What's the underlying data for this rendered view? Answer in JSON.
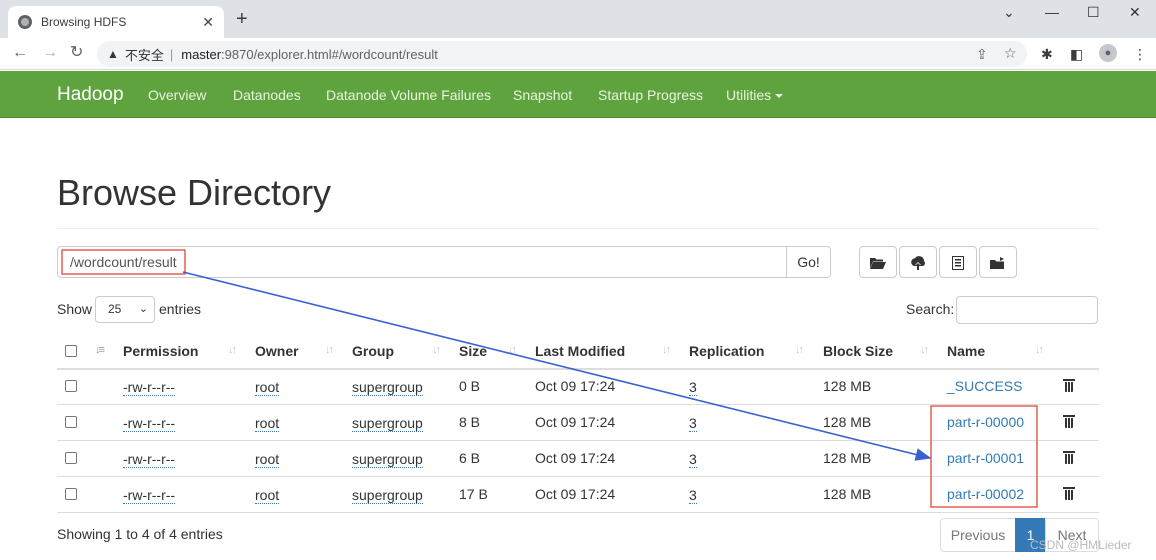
{
  "browser": {
    "tab_title": "Browsing HDFS",
    "tab_close": "✕",
    "new_tab": "+",
    "url_warning": "▲",
    "url_insecure": "不安全",
    "url_sep": "|",
    "url_host": "master",
    "url_path": ":9870/explorer.html#/wordcount/result",
    "win_minimize": "—",
    "win_maximize": "☐",
    "win_close": "✕",
    "win_chevron": "⌄",
    "nav_back": "←",
    "nav_forward": "→",
    "nav_reload": "↻",
    "icons": [
      "share-icon",
      "star-icon",
      "extensions-icon",
      "sidepanel-icon",
      "profile-icon",
      "menu-icon"
    ]
  },
  "navbar": {
    "brand": "Hadoop",
    "items": [
      "Overview",
      "Datanodes",
      "Datanode Volume Failures",
      "Snapshot",
      "Startup Progress",
      "Utilities"
    ]
  },
  "page": {
    "title": "Browse Directory",
    "directory": "/wordcount/result",
    "go_label": "Go!",
    "show_label": "Show",
    "page_size": "25",
    "entries_label": "entries",
    "search_label": "Search:"
  },
  "table": {
    "headers": [
      "Permission",
      "Owner",
      "Group",
      "Size",
      "Last Modified",
      "Replication",
      "Block Size",
      "Name"
    ],
    "rows": [
      {
        "permission": "-rw-r--r--",
        "owner": "root",
        "group": "supergroup",
        "size": "0 B",
        "modified": "Oct 09 17:24",
        "replication": "3",
        "block_size": "128 MB",
        "name": "_SUCCESS"
      },
      {
        "permission": "-rw-r--r--",
        "owner": "root",
        "group": "supergroup",
        "size": "8 B",
        "modified": "Oct 09 17:24",
        "replication": "3",
        "block_size": "128 MB",
        "name": "part-r-00000"
      },
      {
        "permission": "-rw-r--r--",
        "owner": "root",
        "group": "supergroup",
        "size": "6 B",
        "modified": "Oct 09 17:24",
        "replication": "3",
        "block_size": "128 MB",
        "name": "part-r-00001"
      },
      {
        "permission": "-rw-r--r--",
        "owner": "root",
        "group": "supergroup",
        "size": "17 B",
        "modified": "Oct 09 17:24",
        "replication": "3",
        "block_size": "128 MB",
        "name": "part-r-00002"
      }
    ]
  },
  "footer": {
    "info": "Showing 1 to 4 of 4 entries",
    "previous": "Previous",
    "current_page": "1",
    "next": "Next"
  },
  "watermark": "CSDN @HMLieder",
  "colors": {
    "navbar": "#5fa33e",
    "link": "#337ab7",
    "annotation": "#e2453c",
    "arrow": "#3a5fd0",
    "pager_active": "#337ab7"
  }
}
